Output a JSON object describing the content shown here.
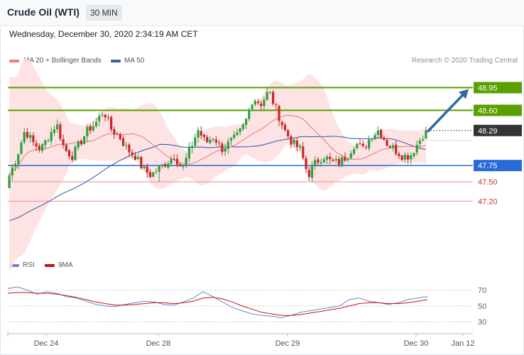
{
  "header": {
    "title": "Crude Oil (WTI)",
    "timeframe": "30 MIN"
  },
  "timestamp": "Wednesday, December 30, 2020 2:34:19 AM CET",
  "legend": {
    "item1": "MA 20 + Bollinger Bands",
    "item2": "MA 50",
    "copyright": "Research © 2020 Trading Central"
  },
  "rsi_legend": {
    "item1": "RSI",
    "item2": "9MA"
  },
  "colors": {
    "up": "#2e9e3e",
    "down": "#c62828",
    "ma20": "#e88080",
    "ma50": "#3c62a8",
    "bands": "#fde0e0",
    "resistance": "#5aa000",
    "support": "#2a6ad6",
    "support_red": "#f28c8c",
    "rsi": "#6688cc",
    "rsi_ma": "#cc1111"
  },
  "chart_data": [
    {
      "type": "candlestick",
      "title": "Crude Oil (WTI)",
      "interval": "30 MIN",
      "ylim": [
        46.45,
        49.25
      ],
      "x_ticks": [
        "Dec 24",
        "Dec 28",
        "Dec 29",
        "Dec 30",
        "Jan 12"
      ],
      "levels": [
        {
          "value": 48.95,
          "label": "48.95",
          "style": "resistance"
        },
        {
          "value": 48.6,
          "label": "48.60",
          "style": "resistance"
        },
        {
          "value": 48.29,
          "label": "48.29",
          "style": "current"
        },
        {
          "value": 47.75,
          "label": "47.75",
          "style": "pivot"
        },
        {
          "value": 47.5,
          "label": "47.50",
          "style": "support"
        },
        {
          "value": 47.2,
          "label": "47.20",
          "style": "support"
        }
      ],
      "series": [
        {
          "name": "MA 20 + Bollinger Bands"
        },
        {
          "name": "MA 50"
        }
      ],
      "candle_anchor_closes": [
        47.6,
        47.9,
        48.3,
        48.1,
        48.0,
        48.2,
        48.4,
        48.0,
        47.9,
        48.1,
        48.3,
        48.4,
        48.6,
        48.3,
        48.2,
        48.0,
        47.9,
        47.7,
        47.6,
        47.7,
        47.8,
        47.9,
        47.7,
        48.0,
        48.3,
        48.1,
        48.2,
        48.0,
        48.1,
        48.2,
        48.4,
        48.8,
        48.7,
        48.9,
        48.6,
        48.3,
        48.1,
        48.0,
        47.6,
        47.8,
        47.9,
        47.8,
        47.8,
        47.9,
        48.1,
        48.0,
        48.2,
        48.3,
        48.1,
        48.0,
        47.9,
        47.9,
        48.1,
        48.3
      ],
      "projection": {
        "from": 48.29,
        "to": 48.95
      }
    },
    {
      "type": "line",
      "title": "RSI",
      "x_ticks": [
        "Dec 24",
        "Dec 28",
        "Dec 29",
        "Dec 30",
        "Jan 12"
      ],
      "y_ticks": [
        70,
        50,
        30
      ],
      "ylim": [
        22,
        85
      ],
      "series": [
        {
          "name": "RSI",
          "values": [
            72,
            74,
            70,
            65,
            68,
            66,
            62,
            60,
            56,
            52,
            50,
            49,
            52,
            54,
            56,
            55,
            52,
            51,
            55,
            60,
            68,
            62,
            55,
            48,
            44,
            40,
            38,
            37,
            35,
            38,
            42,
            44,
            46,
            48,
            50,
            58,
            60,
            56,
            54,
            52,
            54,
            58,
            60,
            62
          ]
        },
        {
          "name": "9MA",
          "values": [
            66,
            67,
            67,
            66,
            66,
            65,
            63,
            61,
            58,
            55,
            53,
            51,
            51,
            52,
            53,
            54,
            54,
            53,
            54,
            56,
            60,
            61,
            59,
            55,
            50,
            46,
            42,
            40,
            38,
            38,
            39,
            41,
            43,
            45,
            47,
            50,
            53,
            54,
            54,
            53,
            53,
            54,
            56,
            58
          ]
        }
      ]
    }
  ]
}
